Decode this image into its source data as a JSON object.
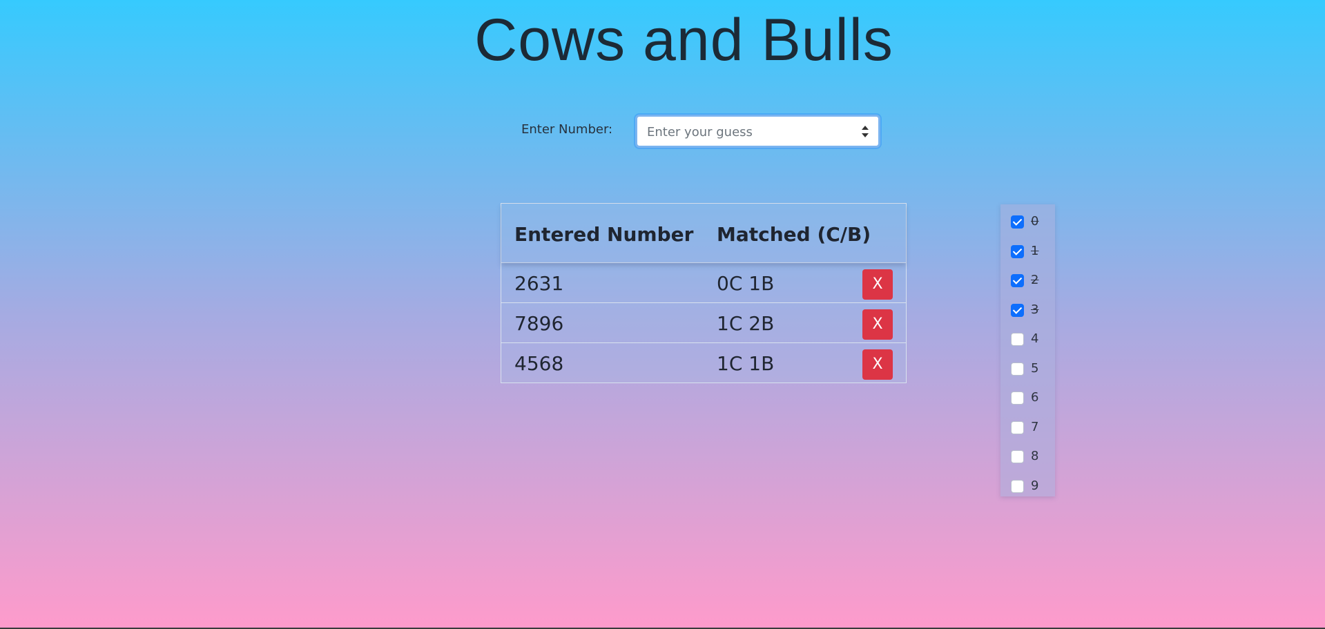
{
  "app": {
    "title": "Cows and Bulls"
  },
  "guess": {
    "label": "Enter Number:",
    "placeholder": "Enter your guess",
    "value": ""
  },
  "history": {
    "headers": [
      "Entered Number",
      "Matched (C/B)"
    ],
    "rows": [
      {
        "number": "2631",
        "match": "0C 1B",
        "delete_label": "X"
      },
      {
        "number": "7896",
        "match": "1C 2B",
        "delete_label": "X"
      },
      {
        "number": "4568",
        "match": "1C 1B",
        "delete_label": "X"
      }
    ]
  },
  "digits": [
    {
      "label": "0",
      "checked": true
    },
    {
      "label": "1",
      "checked": true
    },
    {
      "label": "2",
      "checked": true
    },
    {
      "label": "3",
      "checked": true
    },
    {
      "label": "4",
      "checked": false
    },
    {
      "label": "5",
      "checked": false
    },
    {
      "label": "6",
      "checked": false
    },
    {
      "label": "7",
      "checked": false
    },
    {
      "label": "8",
      "checked": false
    },
    {
      "label": "9",
      "checked": false
    }
  ],
  "colors": {
    "gradient_top": "#36cafe",
    "gradient_bottom": "#fe9bcb",
    "delete_button": "#dc3545",
    "checkbox_checked": "#0d6efd"
  }
}
